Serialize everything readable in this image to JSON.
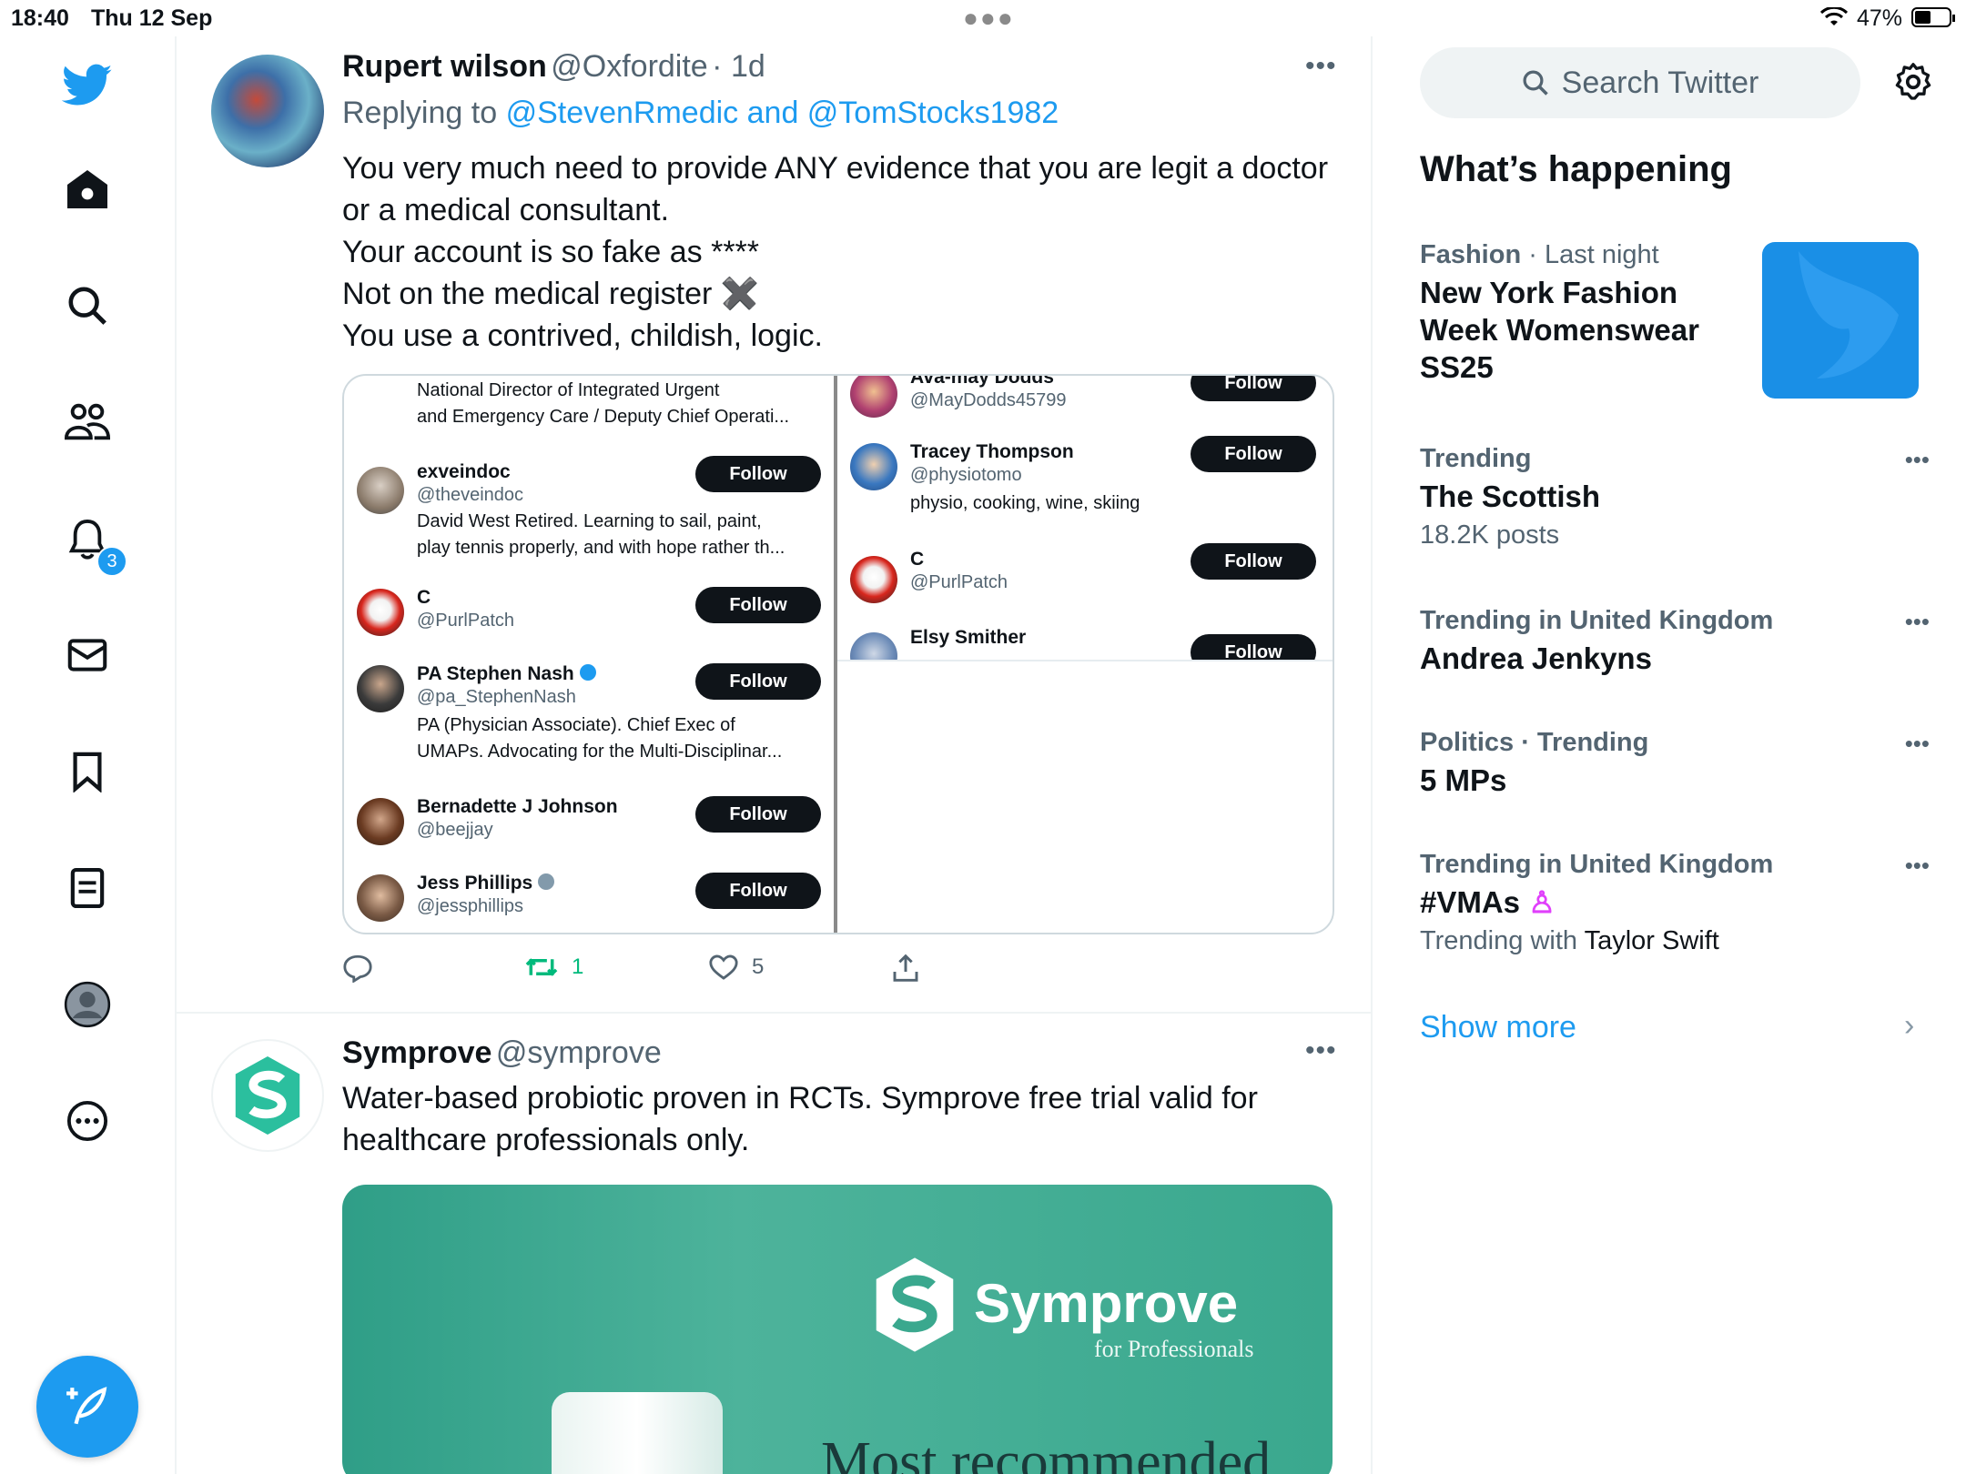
{
  "status": {
    "time": "18:40",
    "date": "Thu 12 Sep",
    "battery": "47%",
    "battery_level": 0.47
  },
  "nav": {
    "notification_count": "3"
  },
  "tweet1": {
    "name": "Rupert wilson",
    "handle": "@Oxfordite",
    "time": "· 1d",
    "replying_prefix": "Replying to",
    "replying_to": "@StevenRmedic and @TomStocks1982",
    "lines": [
      "You very much need to provide ANY evidence that you are legit a doctor",
      "or a medical consultant.",
      "Your account is so fake as ****",
      "Not on the medical register ✖️",
      "You use a contrived, childish, logic."
    ],
    "reply_count": "",
    "retweet_count": "1",
    "like_count": "5"
  },
  "embed": {
    "left_top_bio": [
      "National Director of Integrated Urgent",
      "and Emergency Care / Deputy Chief Operati..."
    ],
    "left_users": [
      {
        "name": "exveindoc",
        "handle": "@theveindoc",
        "bio": [
          "David West Retired. Learning to sail, paint,",
          "play tennis properly, and with hope rather th..."
        ],
        "button": "Follow"
      },
      {
        "name": "C",
        "handle": "@PurlPatch",
        "bio": [],
        "button": "Follow"
      },
      {
        "name": "PA Stephen Nash",
        "handle": "@pa_StephenNash",
        "bio": [
          "PA (Physician Associate). Chief Exec of",
          "UMAPs. Advocating for the Multi-Disciplinar..."
        ],
        "button": "Follow"
      },
      {
        "name": "Bernadette J Johnson",
        "handle": "@beejjay",
        "bio": [],
        "button": "Follow"
      },
      {
        "name": "Jess Phillips",
        "handle": "@jessphillips",
        "bio": [],
        "button": "Follow"
      }
    ],
    "right_users": [
      {
        "name": "Ava-may Dodds",
        "handle": "@MayDodds45799",
        "bio": [],
        "button": "Follow"
      },
      {
        "name": "Tracey Thompson",
        "handle": "@physiotomo",
        "bio": [
          "physio, cooking, wine, skiing"
        ],
        "button": "Follow"
      },
      {
        "name": "C",
        "handle": "@PurlPatch",
        "bio": [],
        "button": "Follow"
      },
      {
        "name": "Elsy Smither",
        "handle": "",
        "bio": [],
        "button": "Follow"
      }
    ]
  },
  "tweet2": {
    "name": "Symprove",
    "handle": "@symprove",
    "lines": [
      "Water-based probiotic proven in RCTs. Symprove free trial valid for",
      "healthcare professionals only."
    ],
    "ad_brand": "Symprove",
    "ad_tagline": "for Professionals",
    "ad_headline": "Most recommended"
  },
  "right": {
    "search_placeholder": "Search Twitter",
    "heading": "What’s happening",
    "trends": [
      {
        "category": "Fashion",
        "meta_rest": " · Last night",
        "title_lines": [
          "New York Fashion",
          "Week Womenswear",
          "SS25"
        ],
        "sub": "",
        "sub_name": ""
      },
      {
        "category": "Trending",
        "meta_rest": "",
        "title_lines": [
          "The Scottish"
        ],
        "sub": "18.2K posts",
        "sub_name": ""
      },
      {
        "category": "Trending in United Kingdom",
        "meta_rest": "",
        "title_lines": [
          "Andrea Jenkyns"
        ],
        "sub": "",
        "sub_name": ""
      },
      {
        "category": "Politics · Trending",
        "meta_rest": "",
        "title_lines": [
          "5 MPs"
        ],
        "sub": "",
        "sub_name": ""
      },
      {
        "category": "Trending in United Kingdom",
        "meta_rest": "",
        "title_lines": [
          "#VMAs"
        ],
        "sub": "Trending with",
        "sub_name": "Taylor Swift"
      }
    ],
    "show_more": "Show more"
  },
  "colors": {
    "accent": "#1d9bf0",
    "text": "#0f1419",
    "muted": "#536471",
    "retweet_green": "#00ba7c",
    "ad_teal": "#3aa88e"
  }
}
